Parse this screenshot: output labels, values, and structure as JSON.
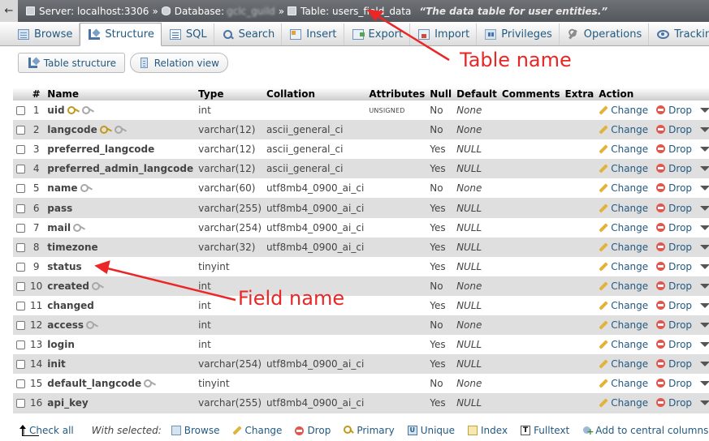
{
  "breadcrumb": {
    "back": "←",
    "server": "Server: localhost:3306",
    "database_label": "Database:",
    "database_name": "gclc_guild",
    "table": "Table: users_field_data",
    "separator": "»",
    "comment": "“The data table for user entities.”"
  },
  "tabs": [
    {
      "label": "Browse",
      "icon": "browse-icon"
    },
    {
      "label": "Structure",
      "icon": "structure-icon",
      "active": true
    },
    {
      "label": "SQL",
      "icon": "sql-icon"
    },
    {
      "label": "Search",
      "icon": "search-icon"
    },
    {
      "label": "Insert",
      "icon": "insert-icon"
    },
    {
      "label": "Export",
      "icon": "export-icon"
    },
    {
      "label": "Import",
      "icon": "import-icon"
    },
    {
      "label": "Privileges",
      "icon": "privileges-icon"
    },
    {
      "label": "Operations",
      "icon": "operations-icon"
    },
    {
      "label": "Tracking",
      "icon": "tracking-icon"
    }
  ],
  "subnav": {
    "table_structure": "Table structure",
    "relation_view": "Relation view"
  },
  "table": {
    "headers": {
      "num": "#",
      "name": "Name",
      "type": "Type",
      "collation": "Collation",
      "attributes": "Attributes",
      "null": "Null",
      "default": "Default",
      "comments": "Comments",
      "extra": "Extra",
      "action": "Action"
    },
    "rows": [
      {
        "num": "1",
        "name": "uid",
        "key": "primary",
        "type": "int",
        "collation": "",
        "attributes": "UNSIGNED",
        "null": "No",
        "default": "None"
      },
      {
        "num": "2",
        "name": "langcode",
        "key": "primary",
        "type": "varchar(12)",
        "collation": "ascii_general_ci",
        "attributes": "",
        "null": "No",
        "default": "None"
      },
      {
        "num": "3",
        "name": "preferred_langcode",
        "key": "",
        "type": "varchar(12)",
        "collation": "ascii_general_ci",
        "attributes": "",
        "null": "Yes",
        "default": "NULL"
      },
      {
        "num": "4",
        "name": "preferred_admin_langcode",
        "key": "",
        "type": "varchar(12)",
        "collation": "ascii_general_ci",
        "attributes": "",
        "null": "Yes",
        "default": "NULL"
      },
      {
        "num": "5",
        "name": "name",
        "key": "index",
        "type": "varchar(60)",
        "collation": "utf8mb4_0900_ai_ci",
        "attributes": "",
        "null": "No",
        "default": "None"
      },
      {
        "num": "6",
        "name": "pass",
        "key": "",
        "type": "varchar(255)",
        "collation": "utf8mb4_0900_ai_ci",
        "attributes": "",
        "null": "Yes",
        "default": "NULL"
      },
      {
        "num": "7",
        "name": "mail",
        "key": "index",
        "type": "varchar(254)",
        "collation": "utf8mb4_0900_ai_ci",
        "attributes": "",
        "null": "Yes",
        "default": "NULL"
      },
      {
        "num": "8",
        "name": "timezone",
        "key": "",
        "type": "varchar(32)",
        "collation": "utf8mb4_0900_ai_ci",
        "attributes": "",
        "null": "Yes",
        "default": "NULL"
      },
      {
        "num": "9",
        "name": "status",
        "key": "",
        "type": "tinyint",
        "collation": "",
        "attributes": "",
        "null": "Yes",
        "default": "NULL"
      },
      {
        "num": "10",
        "name": "created",
        "key": "index",
        "type": "int",
        "collation": "",
        "attributes": "",
        "null": "No",
        "default": "None"
      },
      {
        "num": "11",
        "name": "changed",
        "key": "",
        "type": "int",
        "collation": "",
        "attributes": "",
        "null": "Yes",
        "default": "NULL"
      },
      {
        "num": "12",
        "name": "access",
        "key": "index",
        "type": "int",
        "collation": "",
        "attributes": "",
        "null": "No",
        "default": "None"
      },
      {
        "num": "13",
        "name": "login",
        "key": "",
        "type": "int",
        "collation": "",
        "attributes": "",
        "null": "Yes",
        "default": "NULL"
      },
      {
        "num": "14",
        "name": "init",
        "key": "",
        "type": "varchar(254)",
        "collation": "utf8mb4_0900_ai_ci",
        "attributes": "",
        "null": "Yes",
        "default": "NULL"
      },
      {
        "num": "15",
        "name": "default_langcode",
        "key": "index",
        "type": "tinyint",
        "collation": "",
        "attributes": "",
        "null": "No",
        "default": "None"
      },
      {
        "num": "16",
        "name": "api_key",
        "key": "",
        "type": "varchar(255)",
        "collation": "utf8mb4_0900_ai_ci",
        "attributes": "",
        "null": "Yes",
        "default": "NULL"
      }
    ],
    "actions": {
      "change": "Change",
      "drop": "Drop",
      "more": "More"
    }
  },
  "bottom": {
    "check_all": "Check all",
    "with_selected": "With selected:",
    "browse": "Browse",
    "change": "Change",
    "drop": "Drop",
    "primary": "Primary",
    "unique": "Unique",
    "index": "Index",
    "fulltext": "Fulltext",
    "add_central": "Add to central columns"
  },
  "annotations": {
    "table_name": "Table name",
    "field_name": "Field name",
    "color": "#ea2626"
  }
}
